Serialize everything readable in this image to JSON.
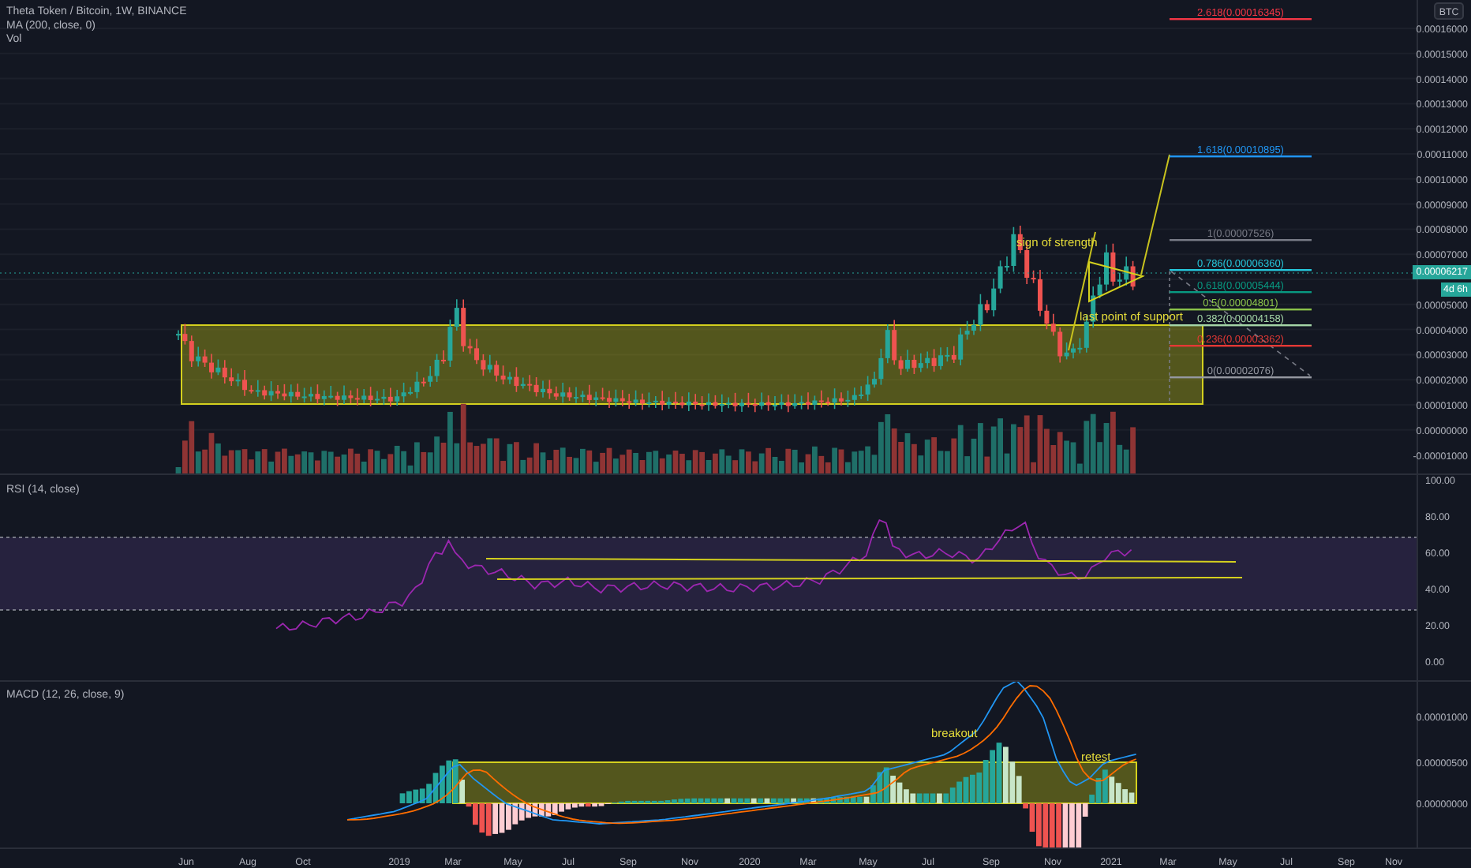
{
  "header": {
    "symbol": "Theta Token / Bitcoin, 1W, BINANCE",
    "indicators": [
      "MA (200, close, 0)",
      "Vol"
    ]
  },
  "price_pane": {
    "currency": "BTC",
    "axis_labels": [
      "0.00016000",
      "0.00015000",
      "0.00014000",
      "0.00013000",
      "0.00012000",
      "0.00011000",
      "0.00010000",
      "0.00009000",
      "0.00008000",
      "0.00007000",
      "0.00005000",
      "0.00004000",
      "0.00003000",
      "0.00002000",
      "0.00001000",
      "0.00000000",
      "-0.00001000"
    ],
    "last_price": "0.00006217",
    "countdown": "4d 6h",
    "fib_levels": [
      {
        "label": "2.618(0.00016345)",
        "color": "#f23645"
      },
      {
        "label": "1.618(0.00010895)",
        "color": "#2196f3"
      },
      {
        "label": "1(0.00007526)",
        "color": "#787b86"
      },
      {
        "label": "0.786(0.00006360)",
        "color": "#26c6da"
      },
      {
        "label": "0.618(0.00005444)",
        "color": "#089981"
      },
      {
        "label": "0.5(0.00004801)",
        "color": "#8bc34a"
      },
      {
        "label": "0.382(0.00004158)",
        "color": "#a5d6a7"
      },
      {
        "label": "0.236(0.00003362)",
        "color": "#e53935"
      },
      {
        "label": "0(0.00002076)",
        "color": "#9598a1"
      }
    ],
    "annotations": [
      "sign of strength",
      "last point of support"
    ]
  },
  "rsi_pane": {
    "title": "RSI (14, close)",
    "axis_labels": [
      "100.00",
      "80.00",
      "60.00",
      "40.00",
      "20.00",
      "0.00"
    ]
  },
  "macd_pane": {
    "title": "MACD (12, 26, close, 9)",
    "axis_labels": [
      "0.00001000",
      "0.00000500",
      "0.00000000"
    ],
    "annotations": [
      "breakout",
      "retest"
    ]
  },
  "time_axis": [
    "Jun",
    "Aug",
    "Oct",
    "2019",
    "Mar",
    "May",
    "Jul",
    "Sep",
    "Nov",
    "2020",
    "Mar",
    "May",
    "Jul",
    "Sep",
    "Nov",
    "2021",
    "Mar",
    "May",
    "Jul",
    "Sep",
    "Nov"
  ]
}
